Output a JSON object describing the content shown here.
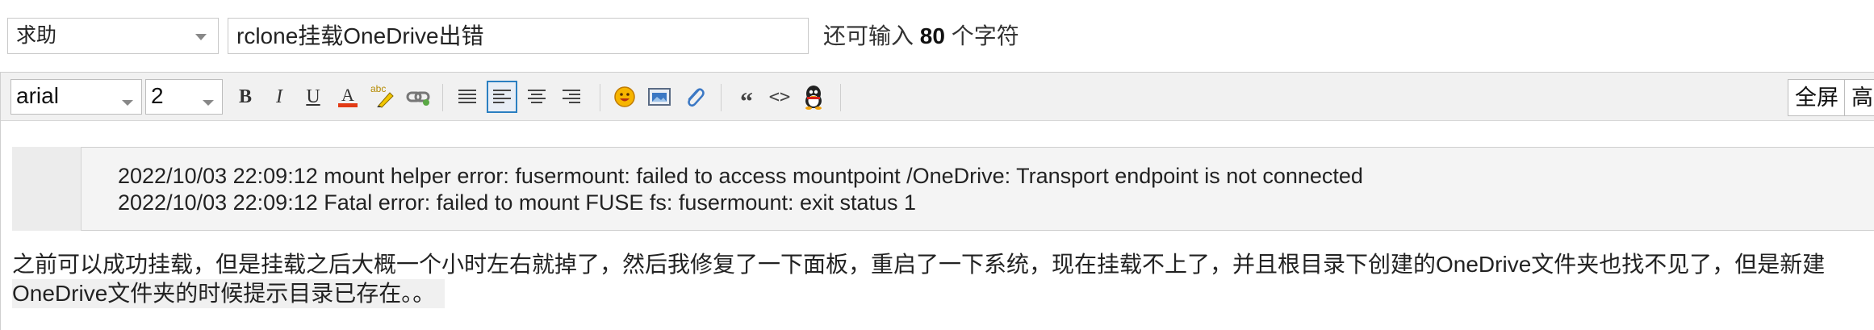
{
  "post_type": {
    "selected": "求助"
  },
  "title": {
    "value": "rclone挂载OneDrive出错"
  },
  "char_counter": {
    "prefix": "还可输入",
    "count": "80",
    "suffix": "个字符"
  },
  "toolbar": {
    "font_family": "arial",
    "font_size": "2",
    "bold": "B",
    "italic": "I",
    "underline": "U",
    "text_color": "A",
    "spell": "abc",
    "quote_glyph": "“",
    "code_glyph": "<>",
    "fullscreen_label": "全屏",
    "height_label": "高"
  },
  "code": {
    "lines": [
      "2022/10/03 22:09:12 mount helper error: fusermount: failed to access mountpoint /OneDrive: Transport endpoint is not connected",
      "2022/10/03 22:09:12 Fatal error: failed to mount FUSE fs: fusermount: exit status 1"
    ]
  },
  "body": {
    "lines": [
      "之前可以成功挂载，但是挂载之后大概一个小时左右就掉了，然后我修复了一下面板，重启了一下系统，现在挂载不上了，并且根目录下创建的OneDrive文件夹也找不见了，但是新建",
      "OneDrive文件夹的时候提示目录已存在。。"
    ]
  },
  "colors": {
    "accent": "#2a7fc1",
    "toolbar_bg": "#f1f1f1",
    "code_bg": "#f4f4f4"
  }
}
